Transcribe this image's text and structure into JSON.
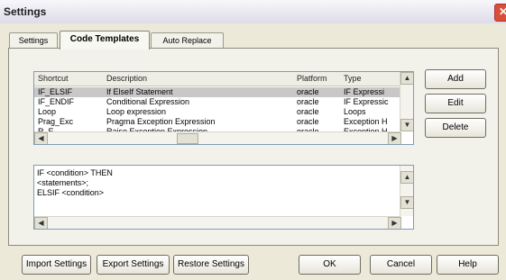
{
  "window": {
    "title": "Settings",
    "close_glyph": "✕"
  },
  "tabs": [
    {
      "label": "Settings",
      "active": false
    },
    {
      "label": "Code Templates",
      "active": true
    },
    {
      "label": "Auto Replace",
      "active": false
    }
  ],
  "templates_table": {
    "columns": [
      "Shortcut",
      "Description",
      "Platform",
      "Type"
    ],
    "rows": [
      {
        "shortcut": "IF_ELSIF",
        "description": "If ElseIf Statement",
        "platform": "oracle",
        "type": "IF Expressi"
      },
      {
        "shortcut": "IF_ENDIF",
        "description": "Conditional Expression",
        "platform": "oracle",
        "type": "IF Expressic"
      },
      {
        "shortcut": "Loop",
        "description": "Loop expression",
        "platform": "oracle",
        "type": "Loops"
      },
      {
        "shortcut": "Prag_Exc",
        "description": "Pragma Exception Expression",
        "platform": "oracle",
        "type": "Exception H"
      },
      {
        "shortcut": "R_E",
        "description": "Raise Exception Expression",
        "platform": "oracle",
        "type": "Exception H"
      }
    ],
    "selected_index": 0
  },
  "side_buttons": {
    "add": "Add",
    "edit": "Edit",
    "delete": "Delete"
  },
  "template_code": {
    "lines": [
      "IF <condition> THEN",
      "  <statements>;",
      "ELSIF <condition>"
    ]
  },
  "bottom_buttons": {
    "import": "Import Settings",
    "export": "Export Settings",
    "restore": "Restore Settings",
    "ok": "OK",
    "cancel": "Cancel",
    "help": "Help"
  },
  "icons": {
    "scroll_up": "▲",
    "scroll_down": "▼",
    "scroll_left": "◀",
    "scroll_right": "▶"
  }
}
